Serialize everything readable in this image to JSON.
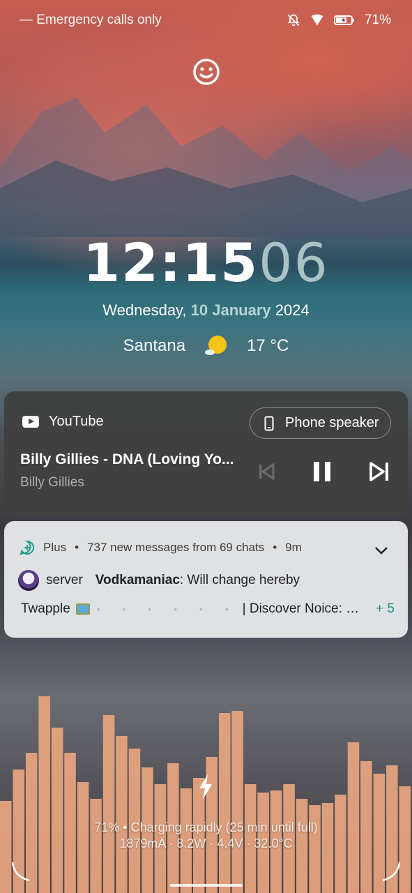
{
  "status_bar": {
    "carrier": "— Emergency calls only",
    "battery_percent": "71%",
    "icons": [
      "notifications-off-icon",
      "wifi-icon",
      "battery-charging-icon"
    ]
  },
  "lockscreen": {
    "face_icon": "smiley-face-icon",
    "clock": {
      "hours_minutes": "12:15",
      "seconds": "06"
    },
    "date": {
      "weekday": "Wednesday,",
      "day_month": "10 January",
      "year": "2024"
    },
    "weather": {
      "location": "Santana",
      "icon": "partly-sunny-icon",
      "temperature": "17 °C"
    }
  },
  "media_player": {
    "app_name": "YouTube",
    "output_device": "Phone speaker",
    "track_title": "Billy Gillies - DNA (Loving Yo...",
    "artist": "Billy Gillies",
    "controls": [
      "previous-icon",
      "pause-icon",
      "next-icon"
    ]
  },
  "notification": {
    "app": "Plus",
    "summary": "737 new messages from 69 chats",
    "time": "9m",
    "separator": "•",
    "line1": {
      "chat": "server",
      "sender": "Vodkamaniac",
      "message": ": Will change hereby"
    },
    "line2": {
      "chat": "Twapple",
      "dots": "• • • • • •",
      "message": "| Discover Noice: Perfect f...",
      "more_count": "+ 5"
    }
  },
  "charging": {
    "status": "71% • Charging rapidly (25 min until full)",
    "stats": "1879mA · 8.2W · 4.4V · 32.0°C",
    "bar_color": "#e9a57f",
    "levels": [
      0.44,
      0.59,
      0.67,
      0.94,
      0.79,
      0.67,
      0.53,
      0.45,
      0.85,
      0.75,
      0.69,
      0.6,
      0.52,
      0.62,
      0.5,
      0.55,
      0.65,
      0.86,
      0.87,
      0.52,
      0.48,
      0.49,
      0.52,
      0.45,
      0.42,
      0.43,
      0.47,
      0.72,
      0.63,
      0.57,
      0.61,
      0.51
    ]
  }
}
